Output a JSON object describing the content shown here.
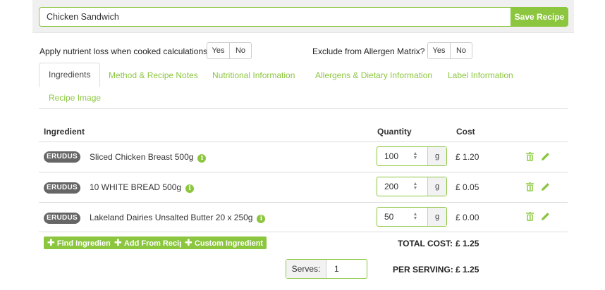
{
  "recipe": {
    "name": "Chicken Sandwich",
    "save_label": "Save Recipe"
  },
  "options": {
    "nutrient_loss_label": "Apply nutrient loss when cooked calculations :",
    "allergen_label": "Exclude from Allergen Matrix? :",
    "yes": "Yes",
    "no": "No"
  },
  "tabs": [
    {
      "label": "Ingredients"
    },
    {
      "label": "Method & Recipe Notes"
    },
    {
      "label": "Nutritional Information"
    },
    {
      "label": "Allergens & Dietary Information"
    },
    {
      "label": "Label Information"
    },
    {
      "label": "Recipe Image"
    }
  ],
  "table": {
    "headers": {
      "ingredient": "Ingredient",
      "quantity": "Quantity",
      "cost": "Cost"
    },
    "rows": [
      {
        "supplier": "ERUDUS",
        "name": "Sliced Chicken Breast 500g",
        "quantity": "100",
        "unit": "g",
        "cost": "£ 1.20"
      },
      {
        "supplier": "ERUDUS",
        "name": "10 WHITE BREAD 500g",
        "quantity": "200",
        "unit": "g",
        "cost": "£ 0.05"
      },
      {
        "supplier": "ERUDUS",
        "name": "Lakeland Dairies Unsalted Butter 20 x 250g",
        "quantity": "50",
        "unit": "g",
        "cost": "£ 0.00"
      }
    ]
  },
  "actions": {
    "find": "Find Ingredients",
    "add_recipe": "Add From Recipe",
    "custom": "Custom Ingredient"
  },
  "totals": {
    "total_label": "TOTAL COST:",
    "total_value": "£ 1.25",
    "per_label": "PER SERVING:",
    "per_value": "£ 1.25"
  },
  "serves": {
    "label": "Serves:",
    "value": "1"
  },
  "colors": {
    "accent": "#8cc63f",
    "badge": "#666666"
  },
  "icons": {
    "info": "info-icon",
    "delete": "trash-icon",
    "edit": "pencil-icon",
    "add": "plus-icon"
  }
}
